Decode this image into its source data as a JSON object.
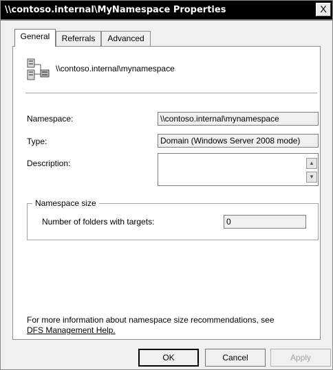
{
  "window": {
    "title": "\\\\contoso.internal\\MyNamespace Properties",
    "close_glyph": "X"
  },
  "tabs": [
    {
      "label": "General",
      "active": true
    },
    {
      "label": "Referrals",
      "active": false
    },
    {
      "label": "Advanced",
      "active": false
    }
  ],
  "general": {
    "namespace_path": "\\\\contoso.internal\\mynamespace",
    "icon": "namespace-server-icon",
    "namespace_label": "Namespace:",
    "namespace_value": "\\\\contoso.internal\\mynamespace",
    "type_label": "Type:",
    "type_value": "Domain (Windows Server 2008 mode)",
    "description_label": "Description:",
    "description_value": "",
    "size_group": {
      "title": "Namespace size",
      "folders_label": "Number of folders with targets:",
      "folders_value": "0"
    },
    "info_text": "For more information about namespace size recommendations, see",
    "help_link": "DFS Management Help."
  },
  "buttons": {
    "ok": "OK",
    "cancel": "Cancel",
    "apply": "Apply"
  }
}
